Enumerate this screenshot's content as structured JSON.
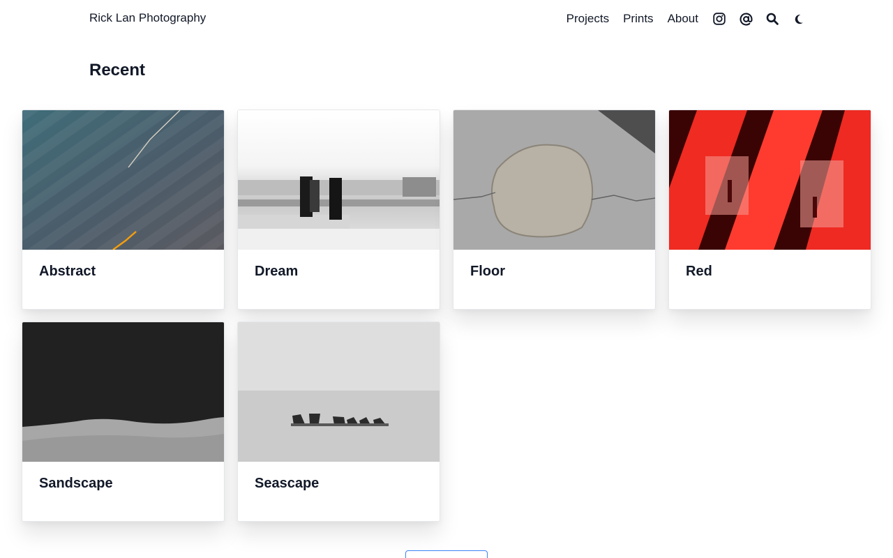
{
  "header": {
    "brand": "Rick Lan Photography",
    "nav": [
      {
        "label": "Projects"
      },
      {
        "label": "Prints"
      },
      {
        "label": "About"
      }
    ],
    "icons": [
      "instagram-icon",
      "at-sign-icon",
      "search-icon",
      "moon-icon"
    ]
  },
  "main": {
    "heading": "Recent",
    "cards": [
      {
        "title": "Abstract"
      },
      {
        "title": "Dream"
      },
      {
        "title": "Floor"
      },
      {
        "title": "Red"
      },
      {
        "title": "Sandscape"
      },
      {
        "title": "Seascape"
      }
    ],
    "more_button": ""
  },
  "colors": {
    "text": "#111827",
    "background": "#ffffff",
    "card_border": "#e5e7eb",
    "button_border": "#3b82f6"
  }
}
